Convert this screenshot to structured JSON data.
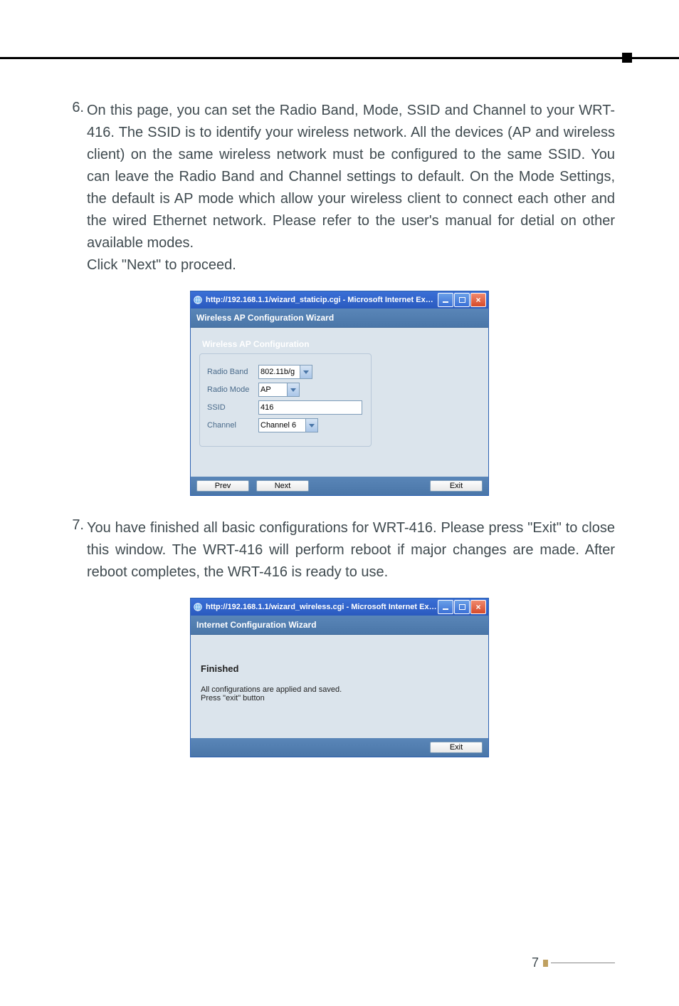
{
  "step6": {
    "num": "6.",
    "text": "On this page, you can set the Radio Band, Mode, SSID and Channel to your WRT-416. The SSID is to identify your wireless network. All the devices (AP and wireless client) on the same wireless network must be configured to the same SSID. You can leave the Radio Band and Channel settings to default. On the Mode Settings, the default is AP mode which allow your wireless client to connect each other and the wired Ethernet network. Please refer to the user's manual for detial on other available modes.",
    "text2": "Click \"Next\" to proceed."
  },
  "step7": {
    "num": "7.",
    "text": "You have finished all basic configurations for WRT-416. Please press \"Exit\" to close this window. The WRT-416 will perform reboot if major changes are made. After reboot completes, the WRT-416 is ready to use."
  },
  "win1": {
    "title": "http://192.168.1.1/wizard_staticip.cgi - Microsoft Internet Expl...",
    "header": "Wireless AP Configuration Wizard",
    "section_title": "Wireless AP Configuration",
    "labels": {
      "radio_band": "Radio Band",
      "radio_mode": "Radio Mode",
      "ssid": "SSID",
      "channel": "Channel"
    },
    "values": {
      "radio_band": "802.11b/g",
      "radio_mode": "AP",
      "ssid": "416",
      "channel": "Channel 6"
    },
    "buttons": {
      "prev": "Prev",
      "next": "Next",
      "exit": "Exit"
    }
  },
  "win2": {
    "title": "http://192.168.1.1/wizard_wireless.cgi - Microsoft Internet Exp...",
    "header": "Internet Configuration Wizard",
    "finished_title": "Finished",
    "finished_text1": "All configurations are applied and saved.",
    "finished_text2": "Press \"exit\" button",
    "buttons": {
      "exit": "Exit"
    }
  },
  "page_number": "7"
}
